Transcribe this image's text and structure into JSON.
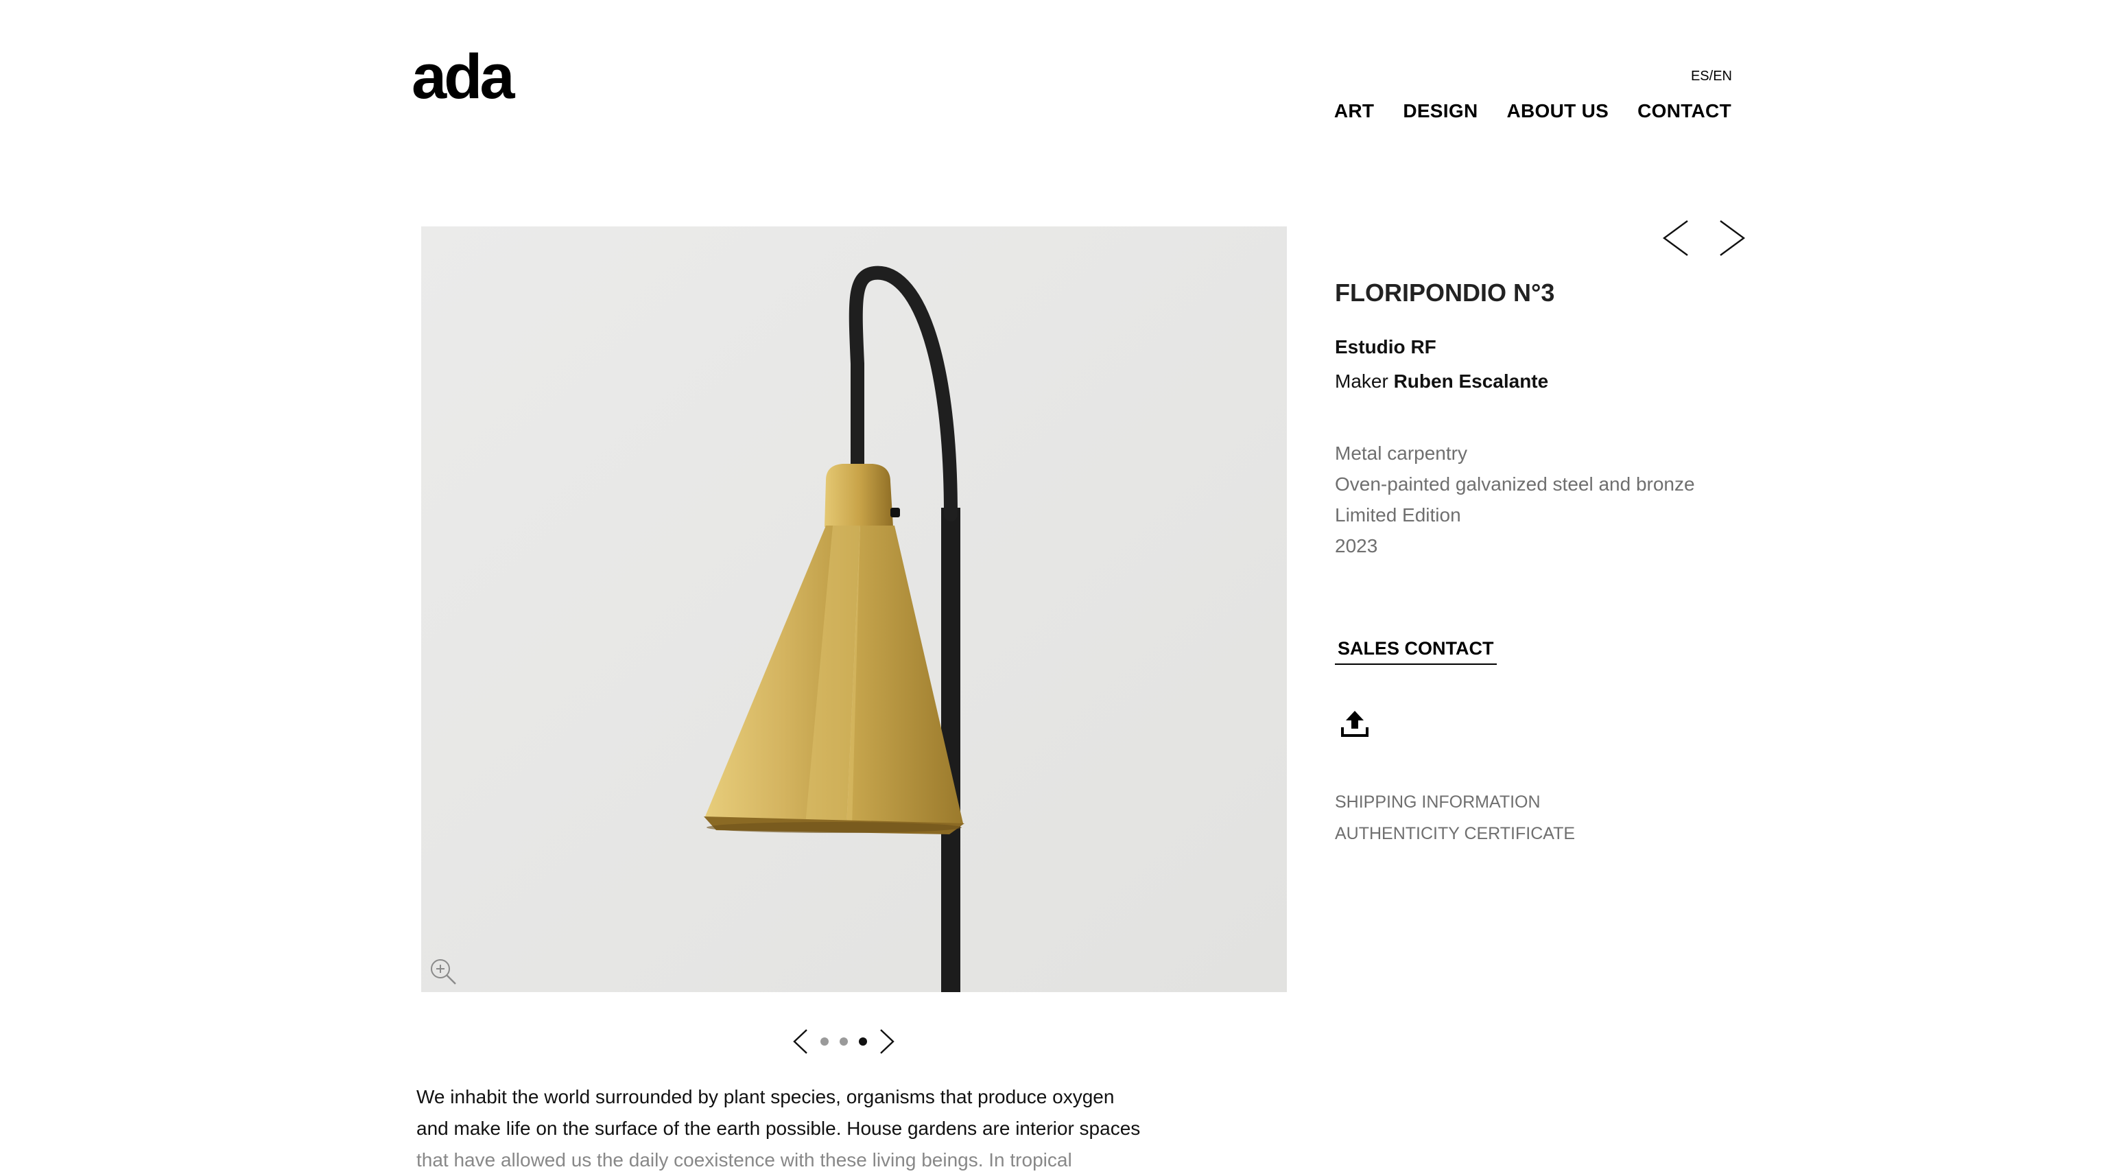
{
  "header": {
    "logo": "ada",
    "language": "ES/EN",
    "nav": [
      "ART",
      "DESIGN",
      "ABOUT US",
      "CONTACT"
    ]
  },
  "product": {
    "title": "FLORIPONDIO N°3",
    "studio": "Estudio RF",
    "maker_label": "Maker",
    "maker_name": "Ruben Escalante",
    "specs": [
      "Metal carpentry",
      "Oven-painted galvanized steel and bronze",
      "Limited Edition",
      "2023"
    ],
    "sales_contact": "SALES CONTACT",
    "links": [
      "SHIPPING INFORMATION",
      "AUTHENTICITY CERTIFICATE"
    ]
  },
  "gallery": {
    "slide_count": 3,
    "active_slide": 3
  },
  "description": {
    "line1": "We inhabit the world surrounded by plant species, organisms that produce oxygen",
    "line2": "and make life on the surface of the earth possible. House gardens are interior spaces",
    "line3": "that have allowed us the daily coexistence with these living beings. In tropical"
  },
  "icons": {
    "zoom": "zoom-in-icon",
    "upload": "upload-icon",
    "prev": "chevron-left-icon",
    "next": "chevron-right-icon"
  },
  "colors": {
    "background": "#ffffff",
    "image_background": "#e8e8e6",
    "brass": "#c9a64a",
    "text_gray": "#6f6f6f"
  }
}
